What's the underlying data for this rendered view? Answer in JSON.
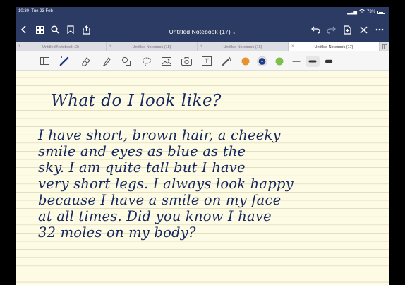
{
  "status": {
    "time": "10:30",
    "date": "Tue 23 Feb",
    "battery": "73%"
  },
  "nav": {
    "title": "Untitled Notebook (17)",
    "icons": [
      "back-chevron-icon",
      "thumbnails-grid-icon",
      "search-icon",
      "bookmark-icon",
      "share-icon",
      "undo-icon",
      "redo-icon",
      "add-page-icon",
      "close-icon",
      "more-icon"
    ]
  },
  "tabs": [
    {
      "label": "Untitled Notebook (2)",
      "active": false
    },
    {
      "label": "Untitled Notebook (18)",
      "active": false
    },
    {
      "label": "Untitled Notebook (16)",
      "active": false
    },
    {
      "label": "Untitled Notebook (17)",
      "active": true
    }
  ],
  "toolbar": {
    "tools": [
      "pages-icon",
      "pen-icon",
      "eraser-icon",
      "highlighter-icon",
      "shapes-icon",
      "lasso-icon",
      "image-icon",
      "camera-icon",
      "text-icon",
      "laser-pointer-icon"
    ],
    "colors": [
      "#e8912f",
      "#1f3a8a",
      "#7cc04a"
    ],
    "selected_color": "#1f3a8a"
  },
  "note": {
    "heading": "What do I look like?",
    "lines": [
      "I have short, brown hair, a cheeky",
      "smile and eyes as blue as the",
      "sky. I am quite tall but I have",
      "very short legs. I always look happy",
      "because I have a smile on my face",
      "at all times. Did you know I have",
      "32 moles on my body?"
    ]
  }
}
